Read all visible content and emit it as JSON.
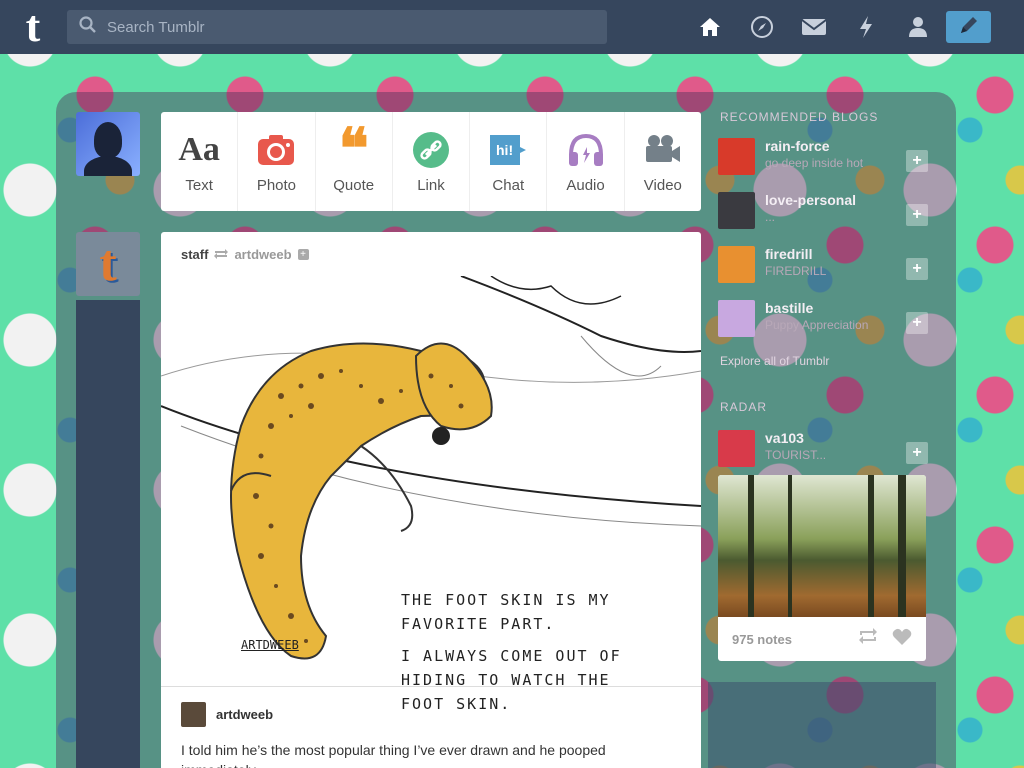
{
  "header": {
    "logo": "t",
    "search_placeholder": "Search Tumblr",
    "nav": [
      "home-icon",
      "explore-icon",
      "inbox-icon",
      "activity-icon",
      "account-icon"
    ],
    "compose_icon": "pencil-icon"
  },
  "post_types": [
    {
      "label": "Text",
      "icon": "Aa",
      "color": "#444444"
    },
    {
      "label": "Photo",
      "icon": "camera",
      "color": "#e8584c"
    },
    {
      "label": "Quote",
      "icon": "❝",
      "color": "#f2992e"
    },
    {
      "label": "Link",
      "icon": "link",
      "color": "#56bc8a"
    },
    {
      "label": "Chat",
      "icon": "hi!",
      "color": "#529ecc"
    },
    {
      "label": "Audio",
      "icon": "headphones",
      "color": "#a77dc2"
    },
    {
      "label": "Video",
      "icon": "camcorder",
      "color": "#748089"
    }
  ],
  "post": {
    "reblogger": "staff",
    "source": "artdweeb",
    "art_caption": [
      "THE FOOT SKIN IS MY",
      "FAVORITE PART.",
      "",
      "I ALWAYS COME OUT OF",
      "HIDING TO WATCH THE",
      "FOOT SKIN."
    ],
    "signature": "ARTDWEEB",
    "author": "artdweeb",
    "body": "I told him he’s the most popular thing I’ve ever drawn and he pooped immediately."
  },
  "sidebar": {
    "recommended_title": "RECOMMENDED BLOGS",
    "blogs": [
      {
        "name": "rain-force",
        "sub": "go deep inside hot",
        "color": "#d83a2a"
      },
      {
        "name": "love-personal",
        "sub": "...",
        "color": "#3a3a40"
      },
      {
        "name": "firedrill",
        "sub": "FIREDRILL",
        "color": "#e89030"
      },
      {
        "name": "bastille",
        "sub": "Puppy Appreciation",
        "color": "#c8a8e0"
      }
    ],
    "explore_label": "Explore all of Tumblr",
    "radar_title": "RADAR",
    "radar_blog": {
      "name": "va103",
      "sub": "TOURIST...",
      "color": "#d83a4a"
    },
    "radar_notes": "975 notes"
  }
}
